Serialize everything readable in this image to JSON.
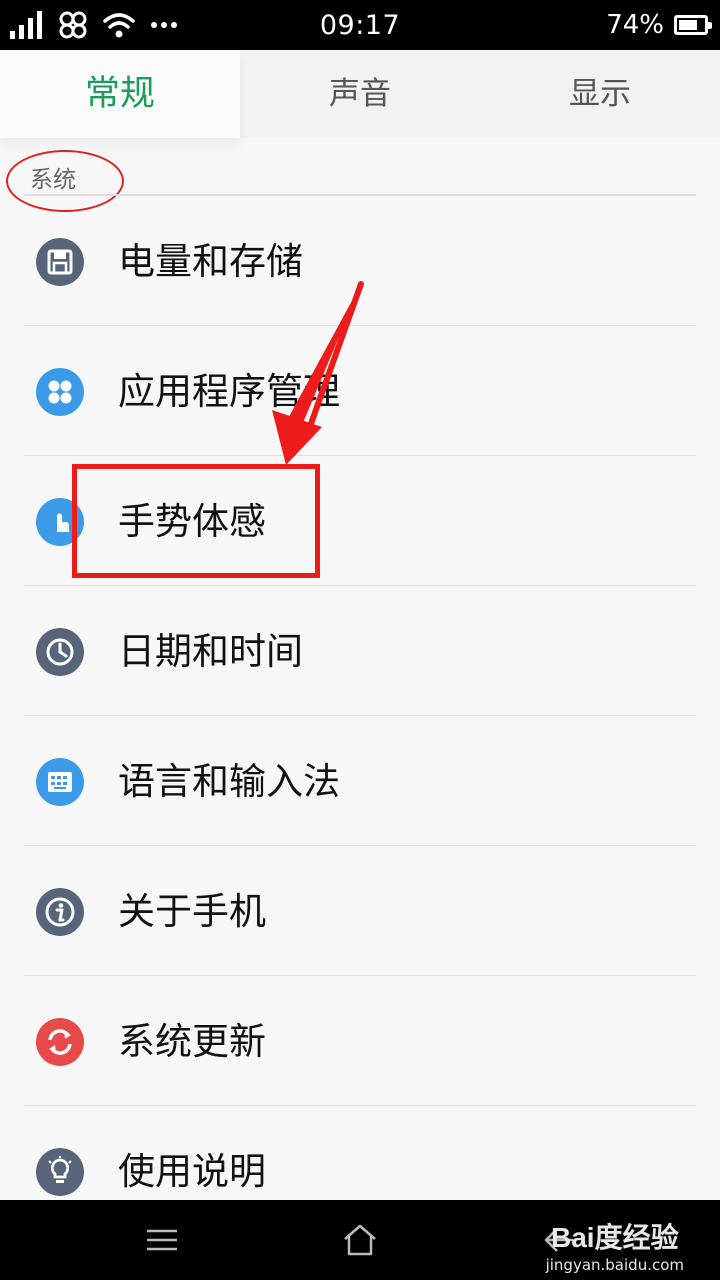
{
  "status_bar": {
    "time": "09:17",
    "battery_percent": "74%",
    "battery_level": 0.74,
    "icons": [
      "signal-icon",
      "unicom-icon",
      "wifi-icon",
      "more-dots-icon",
      "battery-icon"
    ]
  },
  "tabs": [
    {
      "label": "常规",
      "active": true
    },
    {
      "label": "声音",
      "active": false
    },
    {
      "label": "显示",
      "active": false
    }
  ],
  "section": {
    "title": "系统"
  },
  "items": [
    {
      "label": "电量和存储",
      "icon": "storage-icon",
      "color": "#56657a"
    },
    {
      "label": "应用程序管理",
      "icon": "apps-icon",
      "color": "#3b9be8"
    },
    {
      "label": "手势体感",
      "icon": "gesture-icon",
      "color": "#3b9be8"
    },
    {
      "label": "日期和时间",
      "icon": "clock-icon",
      "color": "#56657a"
    },
    {
      "label": "语言和输入法",
      "icon": "keyboard-icon",
      "color": "#3b9be8"
    },
    {
      "label": "关于手机",
      "icon": "info-icon",
      "color": "#56657a"
    },
    {
      "label": "系统更新",
      "icon": "update-icon",
      "color": "#e84a4a"
    },
    {
      "label": "使用说明",
      "icon": "bulb-icon",
      "color": "#56657a"
    }
  ],
  "colors": {
    "accent": "#1a9e5a",
    "annotation": "#ee1b1b"
  },
  "watermark": {
    "main": "Bai度经验",
    "sub": "jingyan.baidu.com"
  },
  "nav": [
    "menu-icon",
    "home-icon",
    "back-icon"
  ]
}
